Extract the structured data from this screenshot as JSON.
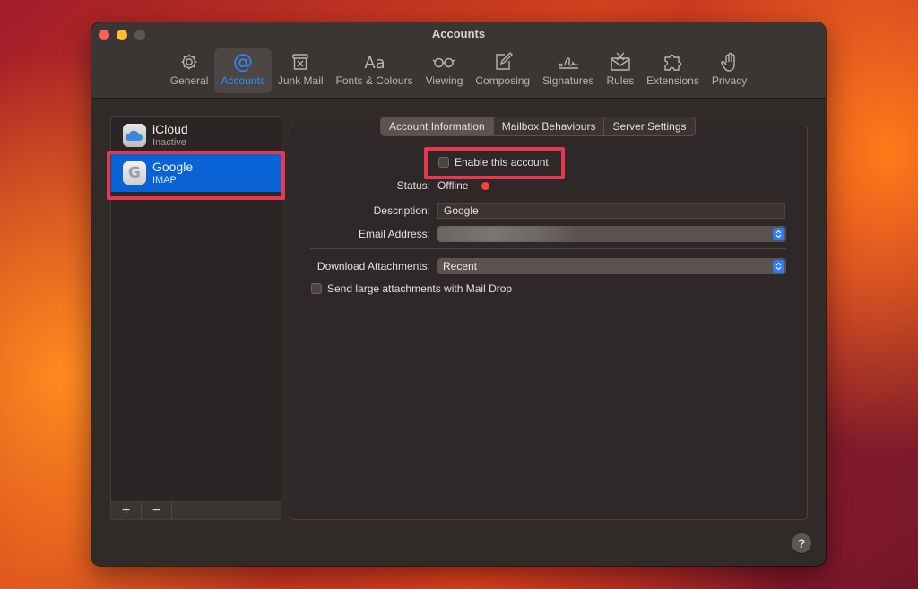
{
  "window": {
    "title": "Accounts"
  },
  "toolbar": [
    {
      "label": "General",
      "icon": "gear-icon",
      "active": false
    },
    {
      "label": "Accounts",
      "icon": "at-icon",
      "active": true
    },
    {
      "label": "Junk Mail",
      "icon": "junk-mail-icon",
      "active": false
    },
    {
      "label": "Fonts & Colours",
      "icon": "fonts-icon",
      "active": false
    },
    {
      "label": "Viewing",
      "icon": "glasses-icon",
      "active": false
    },
    {
      "label": "Composing",
      "icon": "compose-icon",
      "active": false
    },
    {
      "label": "Signatures",
      "icon": "signature-icon",
      "active": false
    },
    {
      "label": "Rules",
      "icon": "rules-icon",
      "active": false
    },
    {
      "label": "Extensions",
      "icon": "puzzle-icon",
      "active": false
    },
    {
      "label": "Privacy",
      "icon": "hand-icon",
      "active": false
    }
  ],
  "accounts": [
    {
      "name": "iCloud",
      "type": "Inactive",
      "icon": "icloud-icon",
      "selected": false
    },
    {
      "name": "Google",
      "type": "IMAP",
      "icon": "google-icon",
      "selected": true
    }
  ],
  "sidebar_buttons": {
    "add": "+",
    "remove": "−"
  },
  "tabs": [
    {
      "label": "Account Information",
      "active": true
    },
    {
      "label": "Mailbox Behaviours",
      "active": false
    },
    {
      "label": "Server Settings",
      "active": false
    }
  ],
  "form": {
    "enable_label": "Enable this account",
    "enable_checked": false,
    "status_label": "Status:",
    "status_value": "Offline",
    "status_color": "#ff453a",
    "description_label": "Description:",
    "description_value": "Google",
    "email_label": "Email Address:",
    "download_label": "Download Attachments:",
    "download_value": "Recent",
    "maildrop_label": "Send large attachments with Mail Drop",
    "maildrop_checked": false
  },
  "help_label": "?",
  "colors": {
    "accent": "#2f8cff",
    "selection": "#0a63d6",
    "highlight": "#e8384f"
  }
}
